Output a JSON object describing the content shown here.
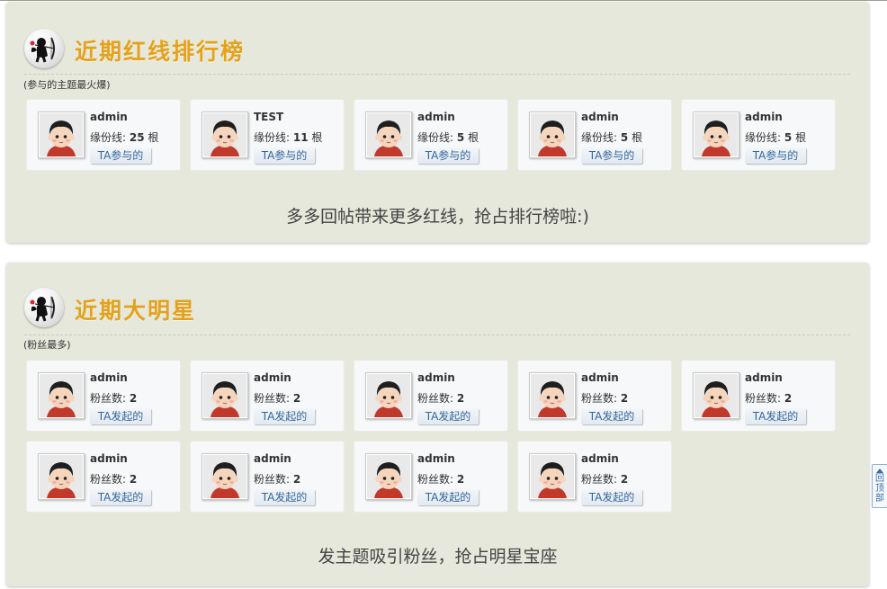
{
  "redline_section": {
    "title": "近期红线排行榜",
    "subtitle": "(参与的主题最火爆)",
    "stat_label": "缘份线:",
    "unit": "根",
    "cards": [
      {
        "name": "admin",
        "value": "25",
        "button": "TA参与的"
      },
      {
        "name": "TEST",
        "value": "11",
        "button": "TA参与的"
      },
      {
        "name": "admin",
        "value": "5",
        "button": "TA参与的"
      },
      {
        "name": "admin",
        "value": "5",
        "button": "TA参与的"
      },
      {
        "name": "admin",
        "value": "5",
        "button": "TA参与的"
      }
    ],
    "message": "多多回帖带来更多红线，抢占排行榜啦:)"
  },
  "star_section": {
    "title": "近期大明星",
    "subtitle": "(粉丝最多)",
    "stat_label": "粉丝数:",
    "cards": [
      {
        "name": "admin",
        "value": "2",
        "button": "TA发起的"
      },
      {
        "name": "admin",
        "value": "2",
        "button": "TA发起的"
      },
      {
        "name": "admin",
        "value": "2",
        "button": "TA发起的"
      },
      {
        "name": "admin",
        "value": "2",
        "button": "TA发起的"
      },
      {
        "name": "admin",
        "value": "2",
        "button": "TA发起的"
      },
      {
        "name": "admin",
        "value": "2",
        "button": "TA发起的"
      },
      {
        "name": "admin",
        "value": "2",
        "button": "TA发起的"
      },
      {
        "name": "admin",
        "value": "2",
        "button": "TA发起的"
      },
      {
        "name": "admin",
        "value": "2",
        "button": "TA发起的"
      }
    ],
    "message": "发主题吸引粉丝，抢占明星宝座"
  },
  "back_to_top": {
    "label": "回顶部"
  },
  "icons": {
    "header": "cupid-icon",
    "avatar": "default-avatar-icon",
    "back_top": "arrow-up-icon"
  },
  "colors": {
    "title": "#e4a21c",
    "panel_bg": "#e6e8db",
    "link": "#336699"
  }
}
